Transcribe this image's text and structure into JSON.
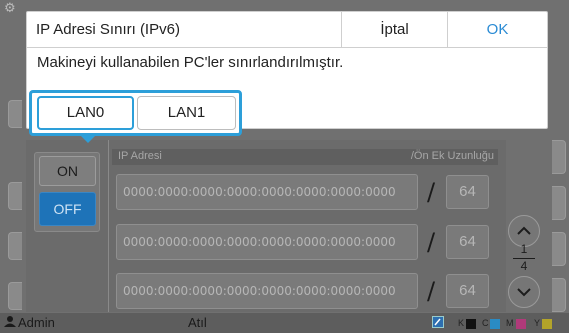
{
  "dialog": {
    "title": "IP Adresi Sınırı (IPv6)",
    "cancel_label": "İptal",
    "ok_label": "OK",
    "message": "Makineyi kullanabilen PC'ler sınırlandırılmıştır."
  },
  "lan_tabs": [
    {
      "label": "LAN0",
      "selected": true
    },
    {
      "label": "LAN1",
      "selected": false
    }
  ],
  "toggle": {
    "on_label": "ON",
    "off_label": "OFF",
    "selected": "OFF"
  },
  "ip_table": {
    "header_address": "IP Adresi",
    "header_prefix": "/Ön Ek Uzunluğu",
    "rows": [
      {
        "address": "0000:0000:0000:0000:0000:0000:0000:0000",
        "prefix": "64"
      },
      {
        "address": "0000:0000:0000:0000:0000:0000:0000:0000",
        "prefix": "64"
      },
      {
        "address": "0000:0000:0000:0000:0000:0000:0000:0000",
        "prefix": "64"
      }
    ]
  },
  "pager": {
    "current": "1",
    "total": "4"
  },
  "status_bar": {
    "user": "Admin",
    "status": "Atıl",
    "ink_labels": [
      "K",
      "C",
      "M",
      "Y"
    ]
  },
  "colors": {
    "accent": "#2d9fd9",
    "ok_text": "#2a8bd4",
    "off_button": "#1e73b8"
  }
}
